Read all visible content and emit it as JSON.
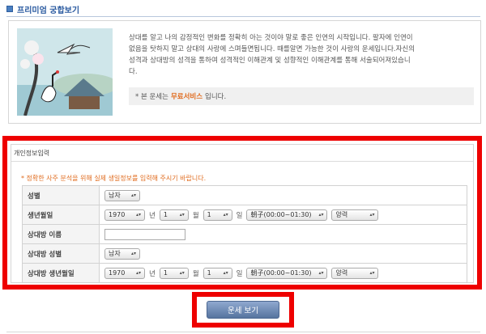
{
  "header": {
    "title": "프리미엄 궁합보기"
  },
  "intro": {
    "lines": [
      "상대를 알고 나의 감정적인 변화를 정확히 아는 것이야 말로 좋은 인연의 시작입니다. 팔자에 인연이",
      "없음을 탓하지 말고 상대의 사랑에 스며들면됩니다. 때를알면 가능한 것이 사랑의 운세입니다.자신의",
      "성격과 상대방의 성격을 통하여 성격적인 이해관계 및 성향적인 이해관계를 통해 서술되어져있습니",
      "다."
    ],
    "notice_prefix": "* 본 운세는",
    "notice_free": "무료서비스",
    "notice_suffix": "입니다."
  },
  "form": {
    "section_title": "개인정보입력",
    "warning": "* 정확한 사주 분석을 위해 실제 생일정보를 입력해 주시기 바랍니다.",
    "units": {
      "year": "년",
      "month": "월",
      "day": "일"
    },
    "rows": {
      "gender": {
        "label": "성별",
        "value": "남자"
      },
      "birth": {
        "label": "생년월일",
        "year": "1970",
        "month": "1",
        "day": "1",
        "hour": "朝子(00:00~01:30)",
        "calendar": "양력"
      },
      "partner_name": {
        "label": "상대방 이름",
        "value": ""
      },
      "partner_gender": {
        "label": "상대방 성별",
        "value": "남자"
      },
      "partner_birth": {
        "label": "상대방 생년월일",
        "year": "1970",
        "month": "1",
        "day": "1",
        "hour": "朝子(00:00~01:30)",
        "calendar": "양력"
      }
    },
    "submit_label": "운세 보기"
  },
  "colors": {
    "accent": "#2a5aa0",
    "highlight_frame": "#ee0000",
    "warning": "#e06b1e",
    "button": "#6b86b2"
  },
  "icons": {
    "title": "square-bullet-icon",
    "select": "updown-arrow-icon"
  }
}
